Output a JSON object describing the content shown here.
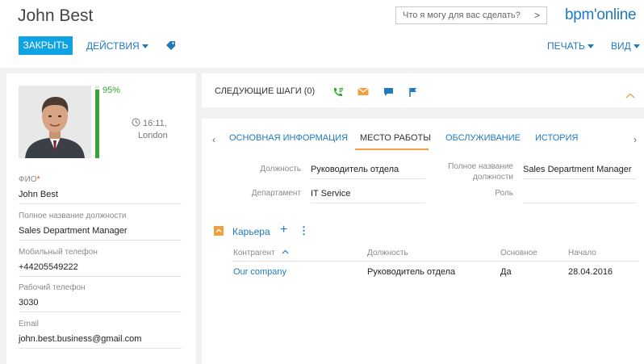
{
  "header": {
    "title": "John Best",
    "search_placeholder": "Что я могу для вас сделать?",
    "logo": "bpm'online",
    "close_label": "ЗАКРЫТЬ",
    "actions_label": "ДЕЙСТВИЯ",
    "print_label": "ПЕЧАТЬ",
    "view_label": "ВИД",
    "accent_color": "#0fa3e3",
    "link_color": "#1f7ac0"
  },
  "profile": {
    "progress": "95%",
    "progress_value": 0.95,
    "time": "16:11,",
    "city": "London",
    "fields": [
      {
        "label": "ФИО",
        "required": "*",
        "value": "John Best"
      },
      {
        "label": "Полное название должности",
        "value": "Sales Department Manager"
      },
      {
        "label": "Мобильный телефон",
        "value": "+44205549222"
      },
      {
        "label": "Рабочий телефон",
        "value": "3030"
      },
      {
        "label": "Email",
        "value": "john.best.business@gmail.com"
      }
    ]
  },
  "next_steps": {
    "label": "СЛЕДУЮЩИЕ ШАГИ (0)",
    "icons": [
      "phone-icon",
      "email-icon",
      "chat-icon",
      "flag-icon"
    ]
  },
  "tabs": [
    {
      "label": "ОСНОВНАЯ ИНФОРМАЦИЯ",
      "active": false
    },
    {
      "label": "МЕСТО РАБОТЫ",
      "active": true
    },
    {
      "label": "ОБСЛУЖИВАНИЕ",
      "active": false
    },
    {
      "label": "ИСТОРИЯ",
      "active": false
    }
  ],
  "job": {
    "position_label": "Должность",
    "position_value": "Руководитель отдела",
    "department_label": "Департамент",
    "department_value": "IT Service",
    "full_title_label_1": "Полное название",
    "full_title_label_2": "должности",
    "full_title_value": "Sales Department Manager",
    "role_label": "Роль",
    "role_value": ""
  },
  "career": {
    "title": "Карьера",
    "columns": [
      "Контрагент",
      "Должность",
      "Основное",
      "Начало"
    ],
    "rows": [
      [
        "Our company",
        "Руководитель отдела",
        "Да",
        "28.04.2016"
      ]
    ]
  }
}
